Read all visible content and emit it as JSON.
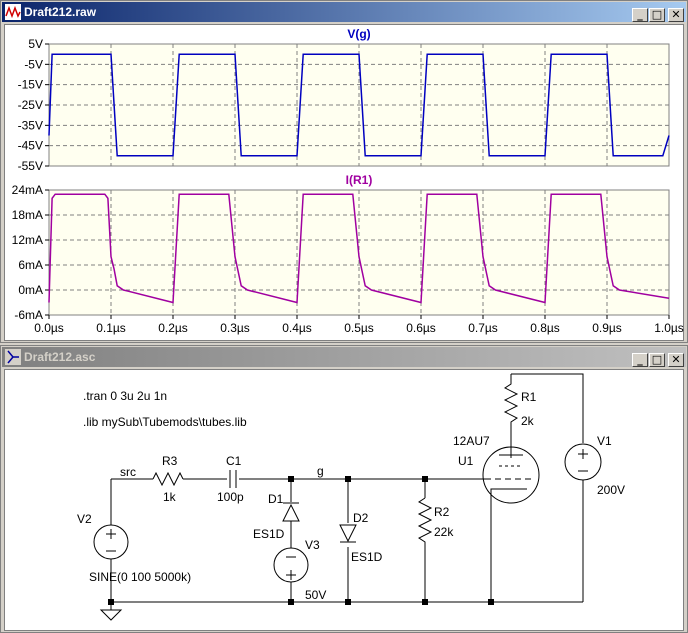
{
  "plot_window": {
    "title": "Draft212.raw",
    "minimize": "_",
    "maximize": "□",
    "close": "✕",
    "pane_top": {
      "trace_label": "V(g)",
      "color": "#0000c0",
      "y_ticks": [
        "5V",
        "-5V",
        "-15V",
        "-25V",
        "-35V",
        "-45V",
        "-55V"
      ]
    },
    "pane_bottom": {
      "trace_label": "I(R1)",
      "color": "#a000a0",
      "y_ticks": [
        "24mA",
        "18mA",
        "12mA",
        "6mA",
        "0mA",
        "-6mA"
      ]
    },
    "x_ticks": [
      "0.0µs",
      "0.1µs",
      "0.2µs",
      "0.3µs",
      "0.4µs",
      "0.5µs",
      "0.6µs",
      "0.7µs",
      "0.8µs",
      "0.9µs",
      "1.0µs"
    ]
  },
  "chart_data": [
    {
      "type": "line",
      "title": "V(g)",
      "x": [
        0,
        0.005,
        0.01,
        0.09,
        0.1,
        0.11,
        0.19,
        0.2,
        0.21,
        0.29,
        0.3,
        0.31,
        0.39,
        0.4,
        0.41,
        0.49,
        0.5,
        0.51,
        0.59,
        0.6,
        0.61,
        0.69,
        0.7,
        0.71,
        0.79,
        0.8,
        0.81,
        0.89,
        0.9,
        0.91,
        0.99,
        1.0
      ],
      "y": [
        -40,
        0,
        0,
        0,
        0,
        -50,
        -50,
        -50,
        0,
        0,
        0,
        -50,
        -50,
        -50,
        0,
        0,
        0,
        -50,
        -50,
        -50,
        0,
        0,
        0,
        -50,
        -50,
        -50,
        0,
        0,
        0,
        -50,
        -50,
        -40
      ],
      "ylim": [
        -55,
        5
      ],
      "xlim": [
        0,
        1.0
      ],
      "grid": true
    },
    {
      "type": "line",
      "title": "I(R1)",
      "x": [
        0,
        0.005,
        0.01,
        0.09,
        0.095,
        0.1,
        0.105,
        0.11,
        0.12,
        0.2,
        0.21,
        0.29,
        0.3,
        0.31,
        0.32,
        0.4,
        0.41,
        0.49,
        0.5,
        0.51,
        0.52,
        0.6,
        0.61,
        0.69,
        0.7,
        0.71,
        0.72,
        0.8,
        0.81,
        0.89,
        0.9,
        0.91,
        0.92,
        1.0
      ],
      "y": [
        -3,
        22,
        23,
        23,
        22,
        8,
        5,
        1,
        0,
        -3,
        23,
        23,
        8,
        1,
        0,
        -3,
        23,
        23,
        8,
        1,
        0,
        -3,
        23,
        23,
        8,
        1,
        0,
        -3,
        23,
        23,
        8,
        1,
        0,
        -2
      ],
      "ylim": [
        -6,
        24
      ],
      "xlim": [
        0,
        1.0
      ],
      "grid": true
    }
  ],
  "schematic_window": {
    "title": "Draft212.asc",
    "minimize": "_",
    "maximize": "□",
    "close": "✕",
    "directive_tran": ".tran 0 3u 2u 1n",
    "directive_lib": ".lib mySub\\Tubemods\\tubes.lib",
    "net_src": "src",
    "net_g": "g",
    "r3_name": "R3",
    "r3_value": "1k",
    "c1_name": "C1",
    "c1_value": "100p",
    "d1_name": "D1",
    "d1_model": "ES1D",
    "d2_name": "D2",
    "d2_model": "ES1D",
    "v3_name": "V3",
    "v3_value": "50V",
    "v2_name": "V2",
    "v2_value": "SINE(0 100 5000k)",
    "r2_name": "R2",
    "r2_value": "22k",
    "r1_name": "R1",
    "r1_value": "2k",
    "u1_model": "12AU7",
    "u1_name": "U1",
    "v1_name": "V1",
    "v1_value": "200V"
  }
}
